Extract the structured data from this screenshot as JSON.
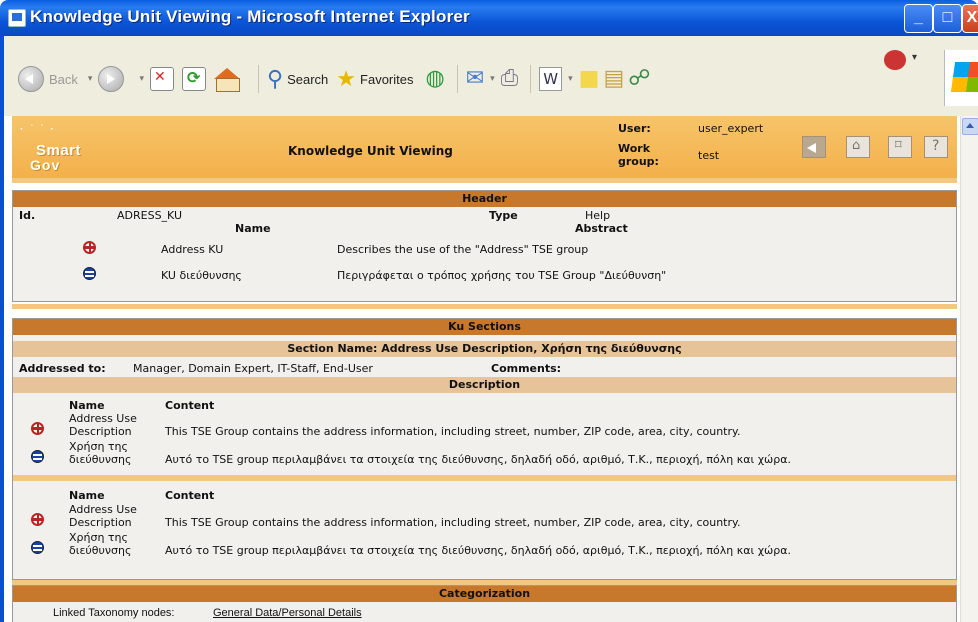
{
  "window": {
    "title": "Knowledge Unit Viewing - Microsoft Internet Explorer",
    "min": "_",
    "max": "□",
    "close": "X"
  },
  "toolbar": {
    "back": "Back",
    "search": "Search",
    "favorites": "Favorites"
  },
  "app_header": {
    "logo_top": "Smart",
    "logo_bottom": "Gov",
    "title": "Knowledge Unit Viewing",
    "user_label": "User:",
    "user_value": "user_expert",
    "workgroup_label_1": "Work",
    "workgroup_label_2": "group:",
    "workgroup_value": "test"
  },
  "header_section": {
    "bar": "Header",
    "id_label": "Id.",
    "id_value": "ADRESS_KU",
    "type_label": "Type",
    "type_value": "Help",
    "name_label": "Name",
    "abstract_label": "Abstract",
    "rows": [
      {
        "flag": "uk-flag-icon",
        "name": "Address KU",
        "abstract": "Describes the use of the \"Address\" TSE group"
      },
      {
        "flag": "greek-flag-icon",
        "name": "KU διεύθυνσης",
        "abstract": "Περιγράφεται ο τρόπος χρήσης του TSE Group \"Διεύθυνση\""
      }
    ]
  },
  "ku_sections": {
    "bar": "Ku Sections",
    "section_name": "Section Name: Address Use Description, Χρήση της διεύθυνσης",
    "addressed_label": "Addressed to:",
    "addressed_value": "Manager, Domain Expert, IT-Staff, End-User",
    "comments_label": "Comments:",
    "description_bar": "Description",
    "blocks": [
      {
        "name_label": "Name",
        "content_label": "Content",
        "rows": [
          {
            "name1": "Address Use",
            "name2": "Description",
            "content": "This TSE Group contains the address information, including street, number, ZIP code, area, city, country."
          },
          {
            "name1": "Χρήση της",
            "name2": "διεύθυνσης",
            "content": "Αυτό το TSE group περιλαμβάνει τα στοιχεία της διεύθυνσης, δηλαδή οδό, αριθμό, Τ.Κ., περιοχή, πόλη και χώρα."
          }
        ]
      },
      {
        "name_label": "Name",
        "content_label": "Content",
        "rows": [
          {
            "name1": "Address Use",
            "name2": "Description",
            "content": "This TSE Group contains the address information, including street, number, ZIP code, area, city, country."
          },
          {
            "name1": "Χρήση της",
            "name2": "διεύθυνσης",
            "content": "Αυτό το TSE group περιλαμβάνει τα στοιχεία της διεύθυνσης, δηλαδή οδό, αριθμό, Τ.Κ., περιοχή, πόλη και χώρα."
          }
        ]
      }
    ]
  },
  "categorization": {
    "bar": "Categorization",
    "linked_label": "Linked Taxonomy nodes:",
    "linked_value": "General Data/Personal Details"
  },
  "colors": {
    "title_bar": "#0a5ee0",
    "app_header": "#f4b04a",
    "section_bar": "#c8782a",
    "sub_bar": "#e7c39a"
  }
}
